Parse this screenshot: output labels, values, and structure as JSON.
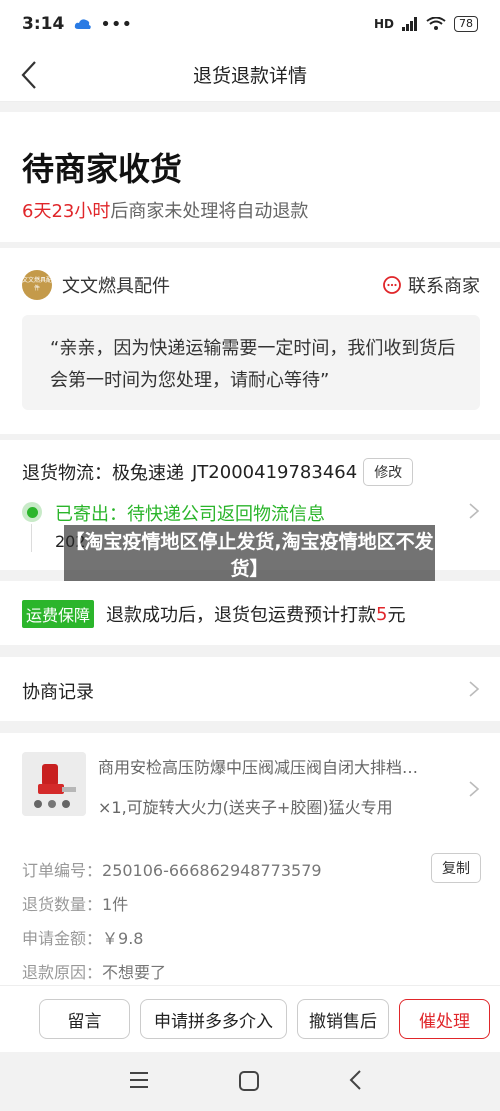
{
  "status_bar": {
    "time": "3:14",
    "network": "HD",
    "battery": "78"
  },
  "nav": {
    "title": "退货退款详情"
  },
  "status": {
    "title": "待商家收货",
    "countdown": "6天23小时",
    "countdown_suffix": "后商家未处理将自动退款"
  },
  "shop": {
    "logo_text": "文文燃具配件",
    "name": "文文燃具配件",
    "contact_label": "联系商家"
  },
  "quote": "“亲亲，因为快递运输需要一定时间，我们收到货后会第一时间为您处理，请耐心等待”",
  "logistics": {
    "label": "退货物流：",
    "carrier": "极兔速递",
    "tracking_no": "JT2000419783464",
    "edit_label": "修改",
    "status_text": "已寄出：待快递公司返回物流信息",
    "date": "202"
  },
  "overlay_text": "【淘宝疫情地区停止发货,淘宝疫情地区不发货】",
  "fee": {
    "badge": "运费保障",
    "text_before": "退款成功后，退货包运费预计打款",
    "amount": "5",
    "unit": "元"
  },
  "negotiation": {
    "label": "协商记录"
  },
  "product": {
    "title": "商用安检高压防爆中压阀减压阀自闭大排档…",
    "spec": "×1,可旋转大火力(送夹子+胶圈)猛火专用"
  },
  "order": {
    "number_label": "订单编号：",
    "number": "250106-666862948773579",
    "copy_label": "复制",
    "qty_label": "退货数量：",
    "qty": "1件",
    "amount_label": "申请金额：",
    "amount": "￥9.8",
    "reason_label": "退款原因：",
    "reason": "不想要了"
  },
  "actions": {
    "message": "留言",
    "pdd": "申请拼多多介入",
    "cancel": "撤销售后",
    "urge": "催处理"
  },
  "colors": {
    "accent_red": "#e0262a",
    "green": "#2bb52b"
  }
}
